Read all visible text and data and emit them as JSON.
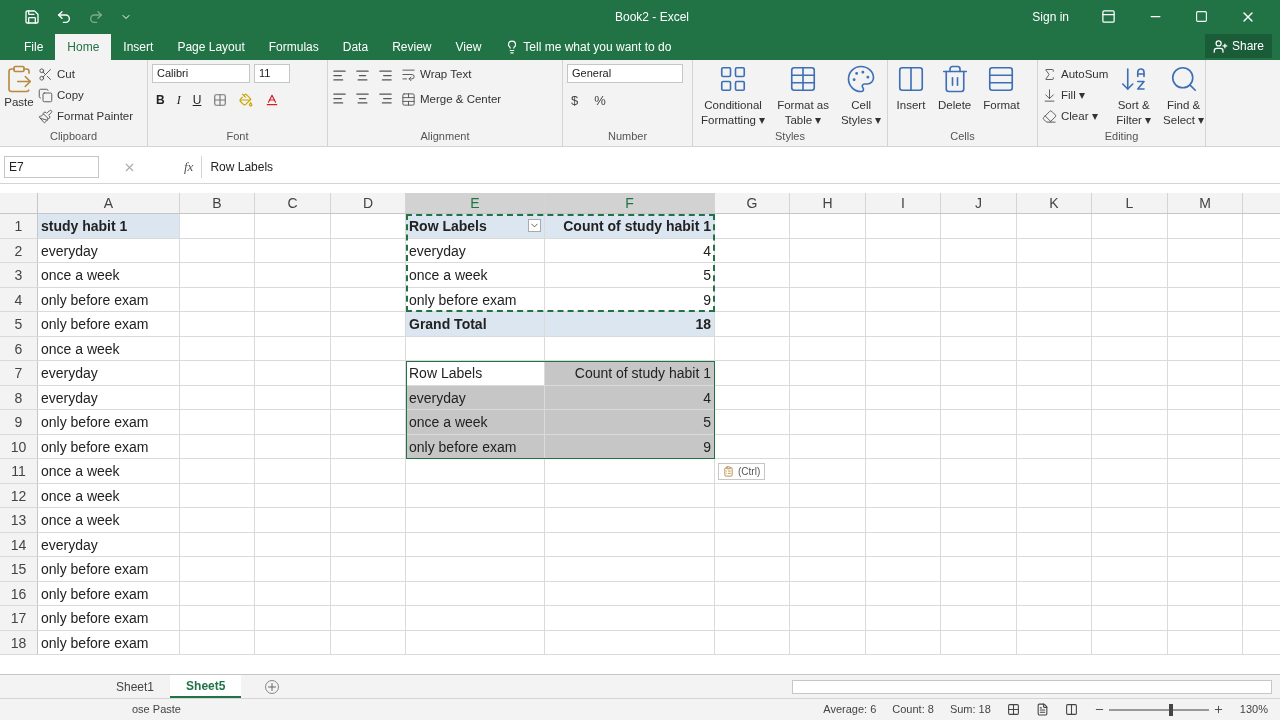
{
  "title_bar": {
    "title": "Book2 - Excel",
    "sign_in": "Sign in"
  },
  "menu_tabs": [
    {
      "label": "File",
      "selected": false
    },
    {
      "label": "Home",
      "selected": true
    },
    {
      "label": "Insert",
      "selected": false
    },
    {
      "label": "Page Layout",
      "selected": false
    },
    {
      "label": "Formulas",
      "selected": false
    },
    {
      "label": "Data",
      "selected": false
    },
    {
      "label": "Review",
      "selected": false
    },
    {
      "label": "View",
      "selected": false
    }
  ],
  "tell_me": "Tell me what you want to do",
  "share": "Share",
  "ribbon": {
    "clipboard": {
      "label": "Clipboard",
      "paste": "Paste",
      "cut": "Cut",
      "copy": "Copy",
      "format_painter": "Format Painter"
    },
    "font": {
      "label": "Font",
      "font_name": "Calibri",
      "font_size": "11",
      "bold": "B",
      "italic": "I",
      "underline": "U"
    },
    "alignment": {
      "label": "Alignment",
      "wrap_text": "Wrap Text",
      "merge_center": "Merge & Center"
    },
    "number": {
      "label": "Number",
      "format": "General",
      "currency": "$",
      "percent": "%"
    },
    "styles": {
      "label": "Styles",
      "buttons": [
        {
          "lines": [
            "Conditional",
            "Formatting ▾"
          ],
          "kind": "conditional"
        },
        {
          "lines": [
            "Format as",
            "Table ▾"
          ],
          "kind": "table"
        },
        {
          "lines": [
            "Cell",
            "Styles ▾"
          ],
          "kind": "cellstyles"
        }
      ]
    },
    "cells": {
      "label": "Cells",
      "buttons": [
        {
          "lines": [
            "Insert"
          ],
          "kind": "insert"
        },
        {
          "lines": [
            "Delete"
          ],
          "kind": "delete"
        },
        {
          "lines": [
            "Format"
          ],
          "kind": "format"
        }
      ]
    },
    "editing": {
      "label": "Editing",
      "autosum": "AutoSum",
      "fill": "Fill ▾",
      "clear": "Clear ▾",
      "buttons": [
        {
          "lines": [
            "Sort &",
            "Filter ▾"
          ],
          "kind": "sort"
        },
        {
          "lines": [
            "Find &",
            "Select ▾"
          ],
          "kind": "find"
        }
      ]
    }
  },
  "name_box": "E7",
  "function_label": "fx",
  "formula": "Row Labels",
  "columns": [
    {
      "label": "A",
      "selected": false
    },
    {
      "label": "B",
      "selected": false
    },
    {
      "label": "C",
      "selected": false
    },
    {
      "label": "D",
      "selected": false
    },
    {
      "label": "E",
      "selected": true
    },
    {
      "label": "F",
      "selected": true
    },
    {
      "label": "G",
      "selected": false
    },
    {
      "label": "H",
      "selected": false
    },
    {
      "label": "I",
      "selected": false
    },
    {
      "label": "J",
      "selected": false
    },
    {
      "label": "K",
      "selected": false
    },
    {
      "label": "L",
      "selected": false
    },
    {
      "label": "M",
      "selected": false
    }
  ],
  "rows": [
    {
      "number": "1",
      "a": "study habit 1",
      "a_bold": true,
      "e": "Row Labels",
      "f": "Count of study habit 1",
      "kind": "pivot_header"
    },
    {
      "number": "2",
      "a": "everyday",
      "a_bold": false,
      "e": "everyday",
      "f": "4",
      "kind": "pivot_item"
    },
    {
      "number": "3",
      "a": "once a week",
      "a_bold": false,
      "e": "once a week",
      "f": "5",
      "kind": "pivot_item"
    },
    {
      "number": "4",
      "a": "only before exam",
      "a_bold": false,
      "e": "only before exam",
      "f": "9",
      "kind": "pivot_item"
    },
    {
      "number": "5",
      "a": "only before exam",
      "a_bold": false,
      "e": "Grand Total",
      "f": "18",
      "kind": "pivot_total"
    },
    {
      "number": "6",
      "a": "once a week",
      "a_bold": false,
      "kind": "blank"
    },
    {
      "number": "7",
      "a": "everyday",
      "a_bold": false,
      "e": "Row Labels",
      "f": "Count of study habit 1",
      "kind": "copy_header"
    },
    {
      "number": "8",
      "a": "everyday",
      "a_bold": false,
      "e": "everyday",
      "f": "4",
      "kind": "copy_item"
    },
    {
      "number": "9",
      "a": "only before exam",
      "a_bold": false,
      "e": "once a week",
      "f": "5",
      "kind": "copy_item"
    },
    {
      "number": "10",
      "a": "only before exam",
      "a_bold": false,
      "e": "only before exam",
      "f": "9",
      "kind": "copy_item"
    },
    {
      "number": "11",
      "a": "once a week",
      "a_bold": false,
      "kind": "blank"
    },
    {
      "number": "12",
      "a": "once a week",
      "a_bold": false,
      "kind": "blank"
    },
    {
      "number": "13",
      "a": "once a week",
      "a_bold": false,
      "kind": "blank"
    },
    {
      "number": "14",
      "a": "everyday",
      "a_bold": false,
      "kind": "blank"
    },
    {
      "number": "15",
      "a": "only before exam",
      "a_bold": false,
      "kind": "blank"
    },
    {
      "number": "16",
      "a": "only before exam",
      "a_bold": false,
      "kind": "blank"
    },
    {
      "number": "17",
      "a": "only before exam",
      "a_bold": false,
      "kind": "blank"
    },
    {
      "number": "18",
      "a": "only before exam",
      "a_bold": false,
      "kind": "blank"
    }
  ],
  "paste_options": "(Ctrl)",
  "sheet_tabs": [
    {
      "label": "Sheet1",
      "selected": false
    },
    {
      "label": "Sheet5",
      "selected": true
    }
  ],
  "status_bar": {
    "message": "ose Paste",
    "average": "Average: 6",
    "count": "Count: 8",
    "sum": "Sum: 18",
    "zoom": "130%",
    "zoom_slider": {
      "level": 0.6
    }
  }
}
